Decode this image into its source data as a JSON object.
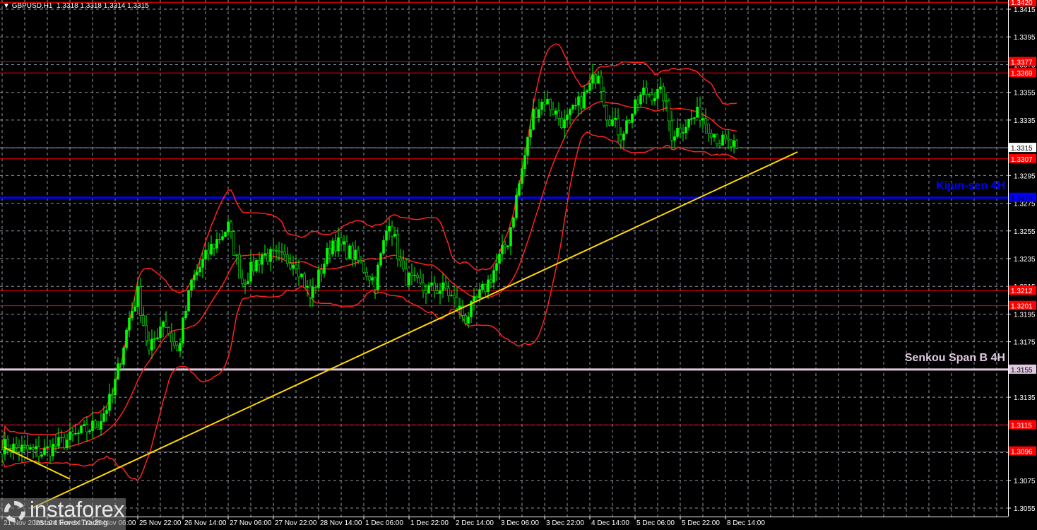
{
  "header": {
    "symbol": "GBPUSD,H1",
    "ohlc": "1.3318 1.3318 1.3314 1.3315",
    "menu_icon": "triangle-down-icon"
  },
  "logo": {
    "brand": "instaforex",
    "tagline": "Instant Forex Trading"
  },
  "colors": {
    "bg": "#000000",
    "candle": "#00ff00",
    "band": "#ff2020",
    "level": "#ff0000",
    "kijun": "#0000ff",
    "senkou": "#e0c8e0",
    "trend": "#ffd700",
    "grid": "#8c96a0",
    "axis": "#ffffff"
  },
  "chart_data": {
    "type": "candlestick",
    "title": "GBPUSD,H1",
    "ylim": [
      1.3045,
      1.3422
    ],
    "y_ticks": [
      "1.3415",
      "1.3395",
      "1.3375",
      "1.3355",
      "1.3335",
      "1.3295",
      "1.3275",
      "1.3255",
      "1.3235",
      "1.3215",
      "1.3195",
      "1.3175",
      "1.3135",
      "1.3075",
      "1.3055"
    ],
    "x_labels": [
      "21 Nov 2025",
      "24 Nov 14:00",
      "25 Nov 06:00",
      "25 Nov 22:00",
      "26 Nov 14:00",
      "27 Nov 06:00",
      "27 Nov 22:00",
      "28 Nov 14:00",
      "1 Dec 06:00",
      "1 Dec 22:00",
      "2 Dec 14:00",
      "3 Dec 06:00",
      "3 Dec 22:00",
      "4 Dec 14:00",
      "5 Dec 06:00",
      "5 Dec 22:00",
      "8 Dec 14:00"
    ],
    "bars_per_label": 16,
    "bar_count": 261,
    "close_path": [
      [
        0,
        1.31
      ],
      [
        14,
        1.3095
      ],
      [
        24,
        1.3105
      ],
      [
        34,
        1.3116
      ],
      [
        39,
        1.3136
      ],
      [
        45,
        1.3192
      ],
      [
        48,
        1.321
      ],
      [
        52,
        1.3167
      ],
      [
        57,
        1.3192
      ],
      [
        62,
        1.3167
      ],
      [
        67,
        1.3218
      ],
      [
        74,
        1.3243
      ],
      [
        80,
        1.3258
      ],
      [
        85,
        1.3218
      ],
      [
        92,
        1.3238
      ],
      [
        104,
        1.3233
      ],
      [
        109,
        1.3207
      ],
      [
        117,
        1.3248
      ],
      [
        124,
        1.3238
      ],
      [
        132,
        1.3218
      ],
      [
        137,
        1.3264
      ],
      [
        142,
        1.3223
      ],
      [
        149,
        1.3213
      ],
      [
        157,
        1.3213
      ],
      [
        164,
        1.3192
      ],
      [
        172,
        1.3218
      ],
      [
        179,
        1.3248
      ],
      [
        183,
        1.3289
      ],
      [
        188,
        1.334
      ],
      [
        192,
        1.335
      ],
      [
        199,
        1.3332
      ],
      [
        207,
        1.3355
      ],
      [
        211,
        1.3371
      ],
      [
        214,
        1.334
      ],
      [
        219,
        1.3325
      ],
      [
        227,
        1.3355
      ],
      [
        234,
        1.3353
      ],
      [
        237,
        1.3325
      ],
      [
        247,
        1.334
      ],
      [
        254,
        1.332
      ],
      [
        260,
        1.3315
      ]
    ],
    "levels": [
      {
        "price": "1.3420",
        "kind": "support-resistance"
      },
      {
        "price": "1.3377",
        "kind": "support-resistance"
      },
      {
        "price": "1.3369",
        "kind": "support-resistance"
      },
      {
        "price": "1.3315",
        "kind": "current-price"
      },
      {
        "price": "1.3307",
        "kind": "support-resistance"
      },
      {
        "price": "1.3279",
        "kind": "kijun",
        "label": "Kijun-sen 4H"
      },
      {
        "price": "1.3212",
        "kind": "support-resistance"
      },
      {
        "price": "1.3201",
        "kind": "support-resistance"
      },
      {
        "price": "1.3155",
        "kind": "senkou",
        "label": "Senkou Span B 4H"
      },
      {
        "price": "1.3115",
        "kind": "support-resistance"
      },
      {
        "price": "1.3096",
        "kind": "support-resistance"
      }
    ],
    "trendlines": [
      {
        "name": "uptrend",
        "from": [
          10.5,
          1.3055
        ],
        "to": [
          281.5,
          1.3312
        ]
      },
      {
        "name": "downtrend",
        "from": [
          0.5,
          1.3099
        ],
        "to": [
          24,
          1.3076
        ]
      }
    ],
    "indicator": "Bollinger Bands (20, 2)"
  }
}
